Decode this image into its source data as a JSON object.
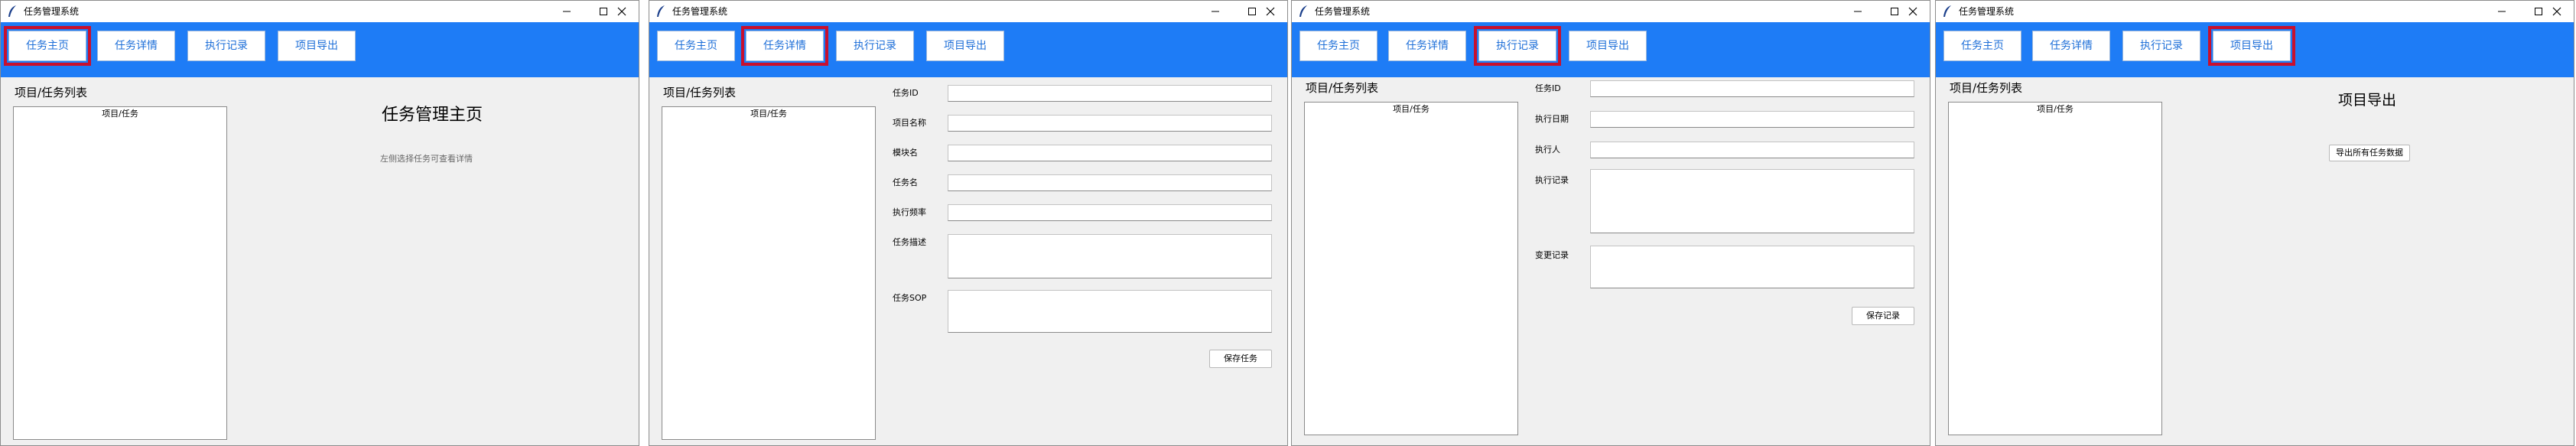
{
  "window": {
    "title": "任务管理系统"
  },
  "nav": {
    "home": "任务主页",
    "detail": "任务详情",
    "records": "执行记录",
    "export": "项目导出"
  },
  "sidebar": {
    "heading": "项目/任务列表",
    "tree_header": "项目/任务"
  },
  "home": {
    "title": "任务管理主页",
    "hint": "左侧选择任务可查看详情"
  },
  "detail": {
    "task_id": "任务ID",
    "project_name": "项目名称",
    "module": "模块名",
    "task_name": "任务名",
    "frequency": "执行频率",
    "description": "任务描述",
    "sop": "任务SOP",
    "save_button": "保存任务"
  },
  "records": {
    "task_id": "任务ID",
    "date": "执行日期",
    "executor": "执行人",
    "exec_record": "执行记录",
    "change_record": "变更记录",
    "save_button": "保存记录"
  },
  "export": {
    "title": "项目导出",
    "button": "导出所有任务数据"
  },
  "colors": {
    "nav_bg": "#1e7cf6",
    "highlight": "#c8102e"
  },
  "icons": [
    "feather-icon",
    "minimize-icon",
    "maximize-icon",
    "close-icon"
  ]
}
